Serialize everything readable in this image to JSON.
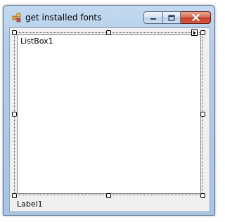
{
  "window": {
    "title": "get installed fonts",
    "icon": "winforms-app-icon",
    "caption_buttons": {
      "minimize_icon": "minimize-icon",
      "maximize_icon": "maximize-icon",
      "close_icon": "close-icon"
    }
  },
  "form": {
    "listbox_text": "ListBox1",
    "label_text": "Label1",
    "smart_tag_icon": "smart-tag-arrow-icon"
  },
  "colors": {
    "close_button": "#c3412a",
    "frame": "#b5cde8",
    "client": "#f0f0f0"
  }
}
